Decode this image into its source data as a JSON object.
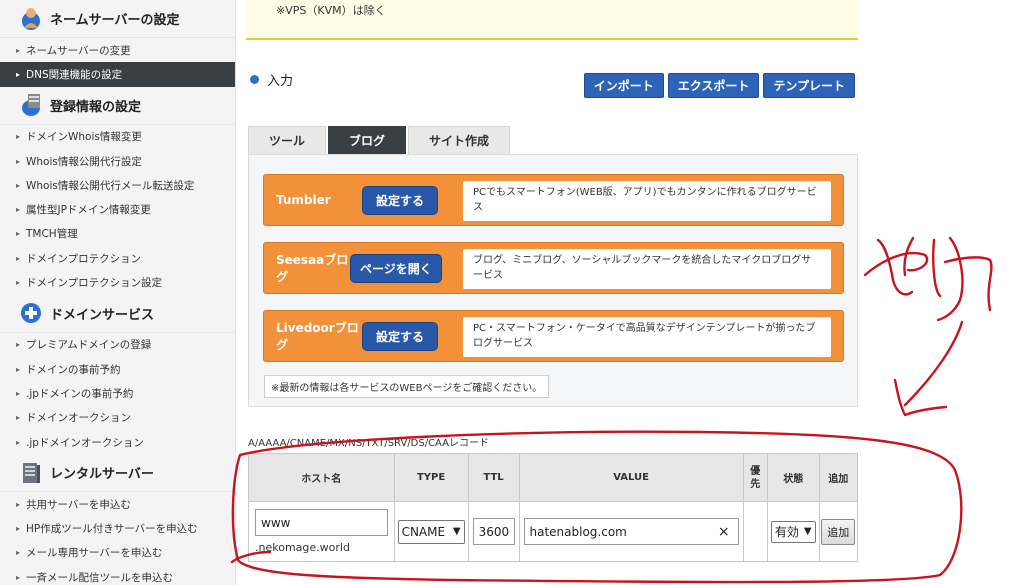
{
  "sidebar": {
    "sections": [
      {
        "title": "ネームサーバーの設定",
        "icon": "globe-user-icon",
        "items": [
          {
            "label": "ネームサーバーの変更",
            "active": false
          },
          {
            "label": "DNS関連機能の設定",
            "active": true
          }
        ]
      },
      {
        "title": "登録情報の設定",
        "icon": "server-db-icon",
        "items": [
          {
            "label": "ドメインWhois情報変更",
            "active": false
          },
          {
            "label": "Whois情報公開代行設定",
            "active": false
          },
          {
            "label": "Whois情報公開代行メール転送設定",
            "active": false
          },
          {
            "label": "属性型JPドメイン情報変更",
            "active": false
          },
          {
            "label": "TMCH管理",
            "active": false
          },
          {
            "label": "ドメインプロテクション",
            "active": false
          },
          {
            "label": "ドメインプロテクション設定",
            "active": false
          }
        ]
      },
      {
        "title": "ドメインサービス",
        "icon": "plus-circle-icon",
        "items": [
          {
            "label": "プレミアムドメインの登録",
            "active": false
          },
          {
            "label": "ドメインの事前予約",
            "active": false
          },
          {
            "label": ".jpドメインの事前予約",
            "active": false
          },
          {
            "label": "ドメインオークション",
            "active": false
          },
          {
            "label": ".jpドメインオークション",
            "active": false
          }
        ]
      },
      {
        "title": "レンタルサーバー",
        "icon": "server-tower-icon",
        "items": [
          {
            "label": "共用サーバーを申込む",
            "active": false
          },
          {
            "label": "HP作成ツール付きサーバーを申込む",
            "active": false
          },
          {
            "label": "メール専用サーバーを申込む",
            "active": false
          },
          {
            "label": "一斉メール配信ツールを申込む",
            "active": false
          }
        ]
      }
    ]
  },
  "main": {
    "notice": "※VPS（KVM）は除く",
    "section_title": "入力",
    "top_buttons": [
      "インポート",
      "エクスポート",
      "テンプレート"
    ],
    "tabs": [
      {
        "label": "ツール",
        "active": false
      },
      {
        "label": "ブログ",
        "active": true
      },
      {
        "label": "サイト作成",
        "active": false
      }
    ],
    "services": [
      {
        "name": "Tumbler",
        "action": "設定する",
        "description": "PCでもスマートフォン(WEB版、アプリ)でもカンタンに作れるブログサービス"
      },
      {
        "name": "Seesaaブログ",
        "action": "ページを開く",
        "description": "ブログ、ミニブログ、ソーシャルブックマークを統合したマイクロブログサービス"
      },
      {
        "name": "Livedoorブログ",
        "action": "設定する",
        "description": "PC・スマートフォン・ケータイで高品質なデザインテンプレートが揃ったブログサービス"
      }
    ],
    "note": "※最新の情報は各サービスのWEBページをご確認ください。",
    "record_label": "A/AAAA/CNAME/MX/NS/TXT/SRV/DS/CAAレコード",
    "table": {
      "headers": {
        "host": "ホスト名",
        "type": "TYPE",
        "ttl": "TTL",
        "value": "VALUE",
        "priority": "優先",
        "status": "状態",
        "add": "追加"
      },
      "row": {
        "host": "www",
        "domain": ".nekomage.world",
        "type": "CNAME",
        "ttl": "3600",
        "value": "hatenablog.com",
        "clear": "×",
        "status": "有効",
        "add_button": "追加"
      }
    }
  },
  "annotation": {
    "handwriting": "やり",
    "color": "#c8141e"
  }
}
